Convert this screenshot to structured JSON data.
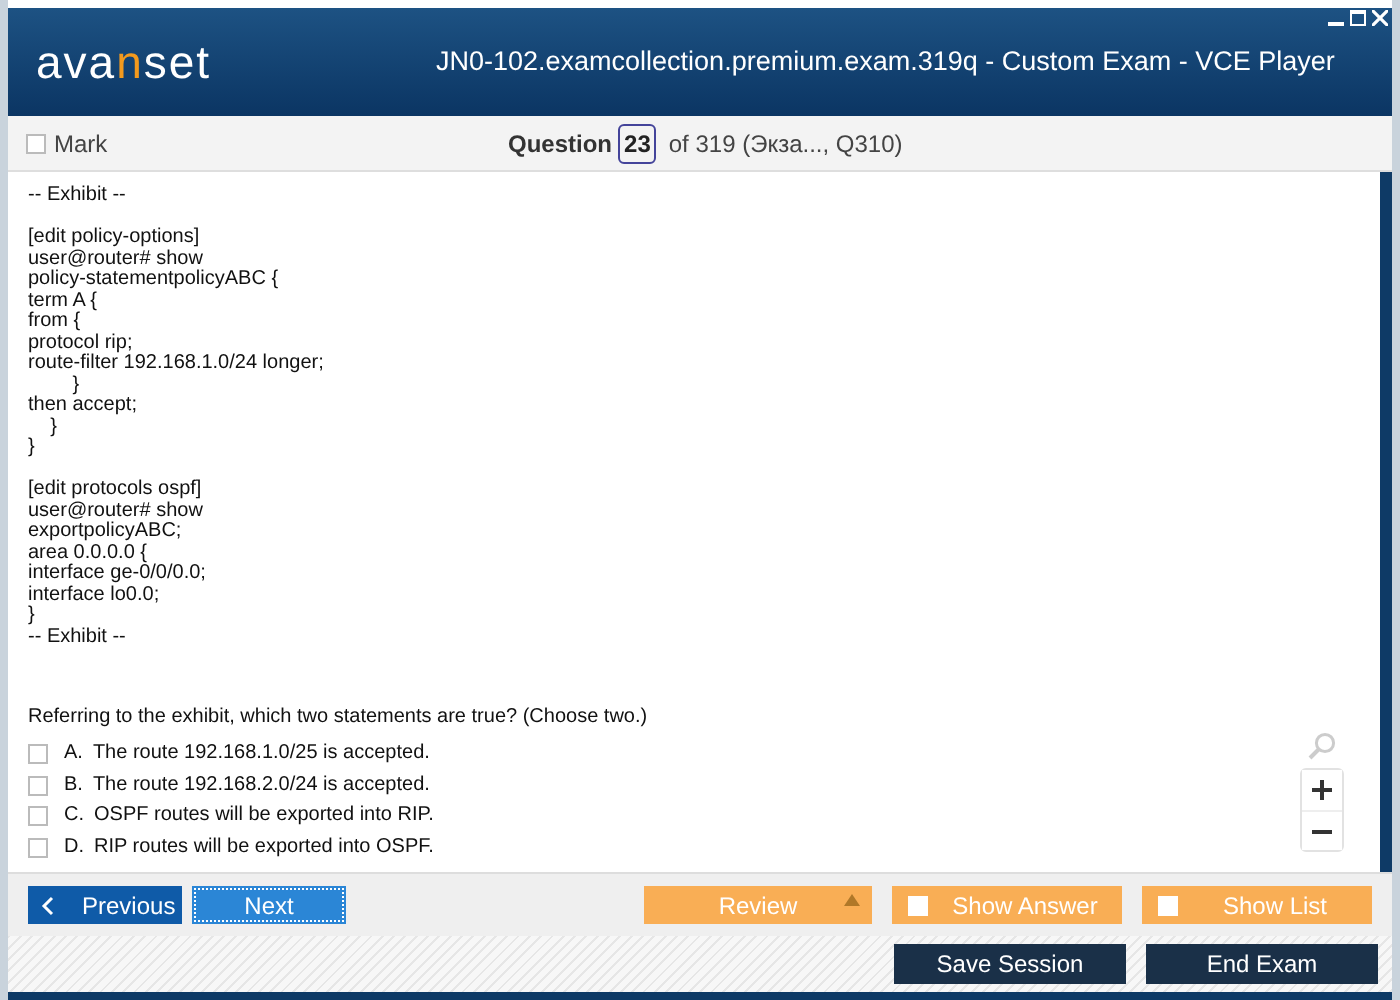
{
  "window": {
    "title": "JN0-102.examcollection.premium.exam.319q - Custom Exam - VCE Player"
  },
  "logo": {
    "parts": [
      {
        "text": "ava",
        "accent": false
      },
      {
        "text": "n",
        "accent": true
      },
      {
        "text": "set",
        "accent": false
      }
    ]
  },
  "toolbar": {
    "mark": {
      "label": "Mark",
      "checked": false
    },
    "question_label": "Question",
    "question_number": "23",
    "question_total": "of 319 (Экза..., Q310)"
  },
  "exhibit": {
    "blocks": [
      [
        "-- Exhibit --"
      ],
      [
        "[edit policy-options]",
        "user@router# show",
        "policy-statementpolicyABC {",
        "term A {",
        "from {",
        "protocol rip;",
        "route-filter 192.168.1.0/24 longer;",
        "        }",
        "then accept;",
        "    }",
        "}"
      ],
      [
        "[edit protocols ospf]",
        "user@router# show",
        "exportpolicyABC;",
        "area 0.0.0.0 {",
        "interface ge-0/0/0.0;",
        "interface lo0.0;",
        "}",
        "-- Exhibit --"
      ]
    ]
  },
  "prompt": "Referring to the exhibit, which two statements are true? (Choose two.)",
  "options": [
    {
      "letter": "A.",
      "text": "The route 192.168.1.0/25 is accepted.",
      "checked": false
    },
    {
      "letter": "B.",
      "text": "The route 192.168.2.0/24 is accepted.",
      "checked": false
    },
    {
      "letter": "C.",
      "text": "OSPF routes will be exported into RIP.",
      "checked": false
    },
    {
      "letter": "D.",
      "text": "RIP routes will be exported into OSPF.",
      "checked": false
    }
  ],
  "nav": {
    "previous": "Previous",
    "next": "Next",
    "review": "Review",
    "show_answer": {
      "label": "Show Answer",
      "checked": false
    },
    "show_list": {
      "label": "Show List",
      "checked": false
    }
  },
  "footer": {
    "buttons": [
      "Save Session",
      "End Exam"
    ]
  }
}
